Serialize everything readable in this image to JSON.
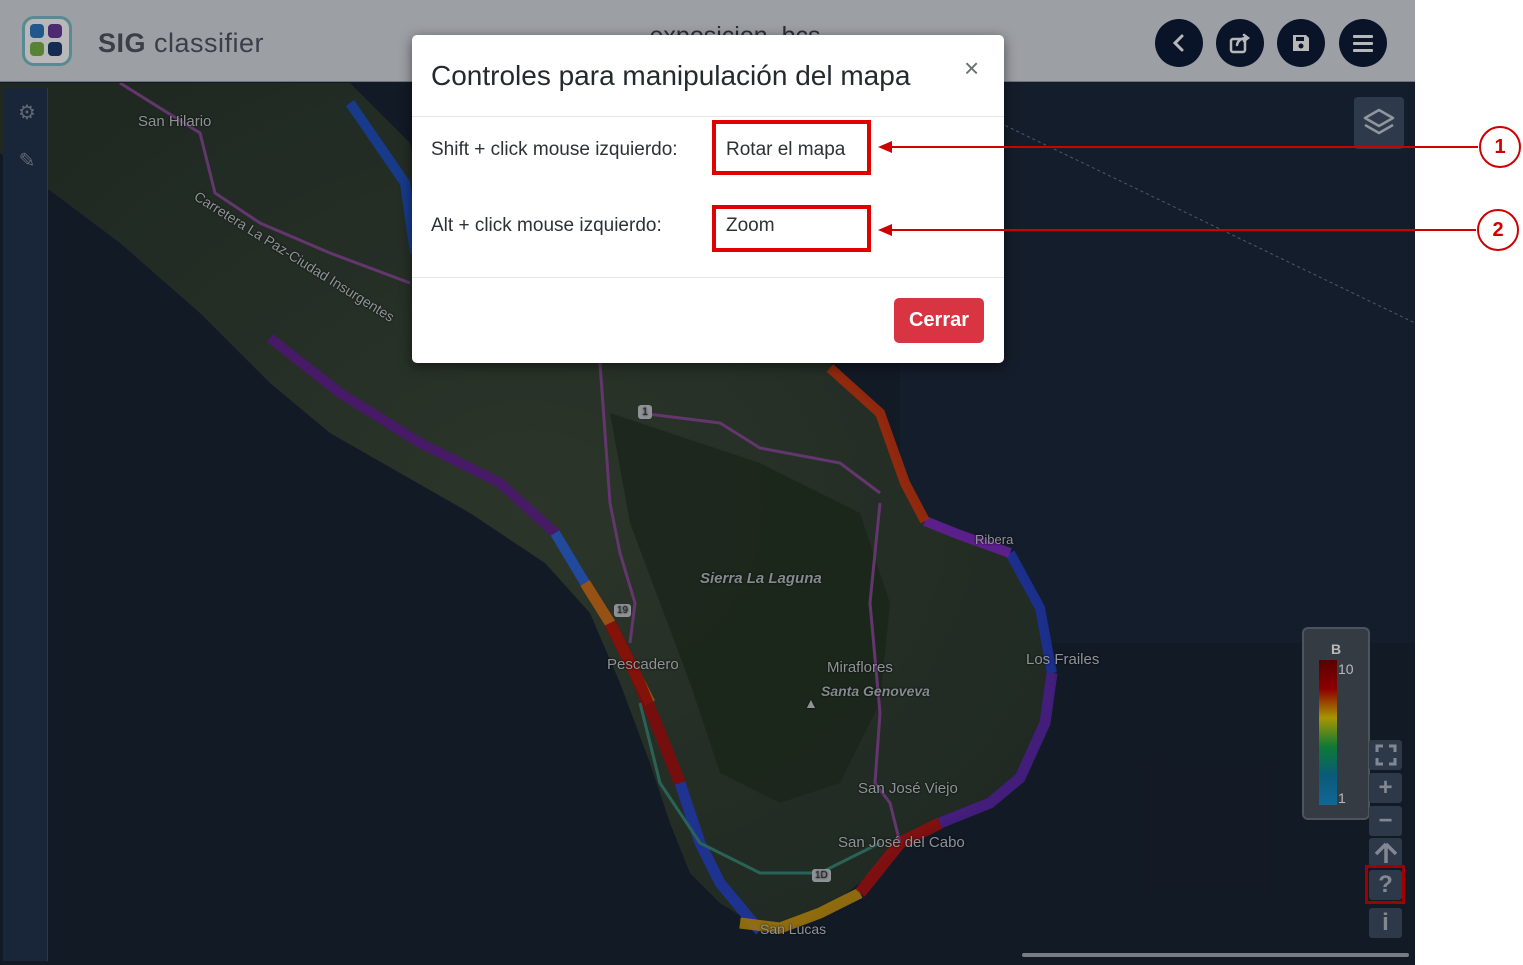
{
  "header": {
    "brand_bold": "SIG",
    "brand_rest": "classifier",
    "document_title": "exposicion_bcs"
  },
  "header_buttons": [
    {
      "name": "back-button",
      "icon": "chevron-left-icon"
    },
    {
      "name": "share-button",
      "icon": "share-icon"
    },
    {
      "name": "save-button",
      "icon": "save-icon"
    },
    {
      "name": "menu-button",
      "icon": "hamburger-menu-icon"
    }
  ],
  "sidebar": {
    "items": [
      {
        "icon": "gears-icon"
      },
      {
        "icon": "brush-icon"
      }
    ]
  },
  "map_labels": {
    "san_hilario": "San Hilario",
    "carretera": "Carretera La Paz-Ciudad Insurgentes",
    "sierra": "Sierra La Laguna",
    "pescadero": "Pescadero",
    "miraflores": "Miraflores",
    "santa_genoveva": "Santa Genoveva",
    "los_frailes": "Los Frailes",
    "san_jose_viejo": "San José Viejo",
    "san_jose_del_cabo": "San José del Cabo",
    "la_ribera": "Ribera",
    "cabo_san_lucas": "San Lucas",
    "highway_1": "1",
    "highway_19": "19",
    "highway_1d": "1D"
  },
  "legend": {
    "title": "B",
    "max": "10",
    "min": "1",
    "colors": [
      "#7b0000",
      "#c40000",
      "#e7d000",
      "#12a84b",
      "#0f7ea8",
      "#1b8fd0"
    ]
  },
  "map_controls": {
    "fullscreen": "⛶",
    "zoom_in": "+",
    "zoom_out": "−",
    "reset_north": "⇧",
    "help": "?",
    "info": "i"
  },
  "modal": {
    "title": "Controles para manipulación del mapa",
    "close_symbol": "×",
    "controls": [
      {
        "shortcut": "Shift + click mouse izquierdo:",
        "action": "Rotar el mapa"
      },
      {
        "shortcut": "Alt + click mouse izquierdo:",
        "action": "Zoom"
      }
    ],
    "close_button": "Cerrar"
  },
  "annotations": [
    "1",
    "2"
  ],
  "colors": {
    "accent_red": "#e00000",
    "header_dark_blue": "#0f1d3a",
    "close_button_red": "#d93441"
  }
}
